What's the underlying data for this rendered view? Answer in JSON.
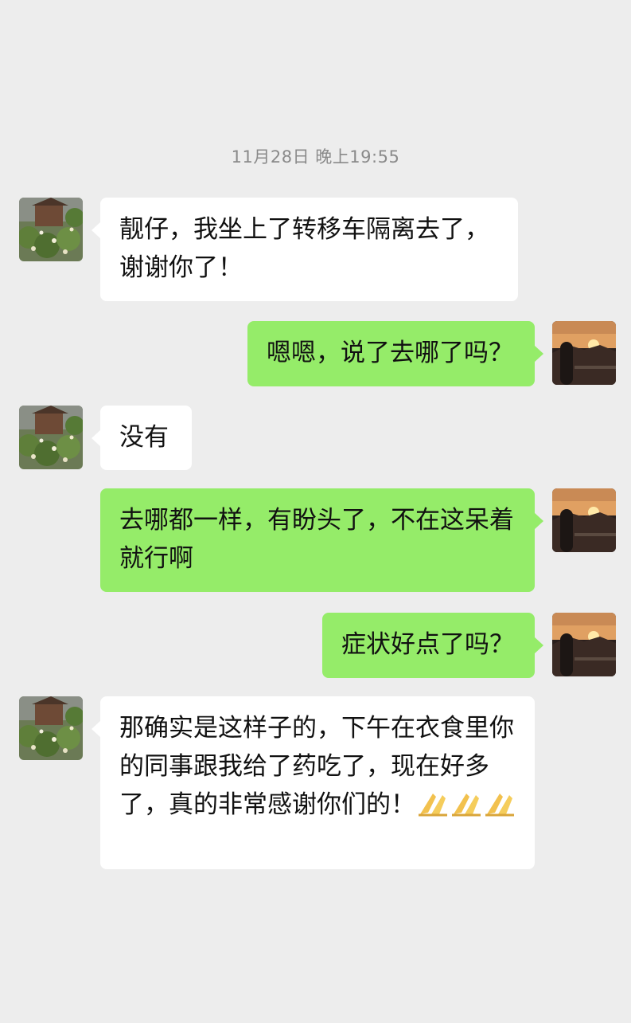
{
  "timestamp": "11月28日 晚上19:55",
  "messages": [
    {
      "side": "in",
      "text": "靓仔，我坐上了转移车隔离去了，谢谢你了！"
    },
    {
      "side": "out",
      "text": "嗯嗯，说了去哪了吗？"
    },
    {
      "side": "in",
      "text": "没有"
    },
    {
      "side": "out",
      "text": "去哪都一样，有盼头了，不在这呆着就行啊"
    },
    {
      "side": "out",
      "text": "症状好点了吗？"
    },
    {
      "side": "in",
      "text": "那确实是这样子的，下午在衣食里你的同事跟我给了药吃了，现在好多了，真的非常感谢你们的！"
    }
  ],
  "emoji": {
    "name": "pray-hands-emoji",
    "count": 3
  },
  "colors": {
    "background": "#ededed",
    "incoming_bubble": "#ffffff",
    "outgoing_bubble": "#95ec69",
    "timestamp_text": "#8a8a8a"
  },
  "avatars": {
    "contact": "garden-photo-avatar",
    "self": "sunset-photo-avatar"
  }
}
